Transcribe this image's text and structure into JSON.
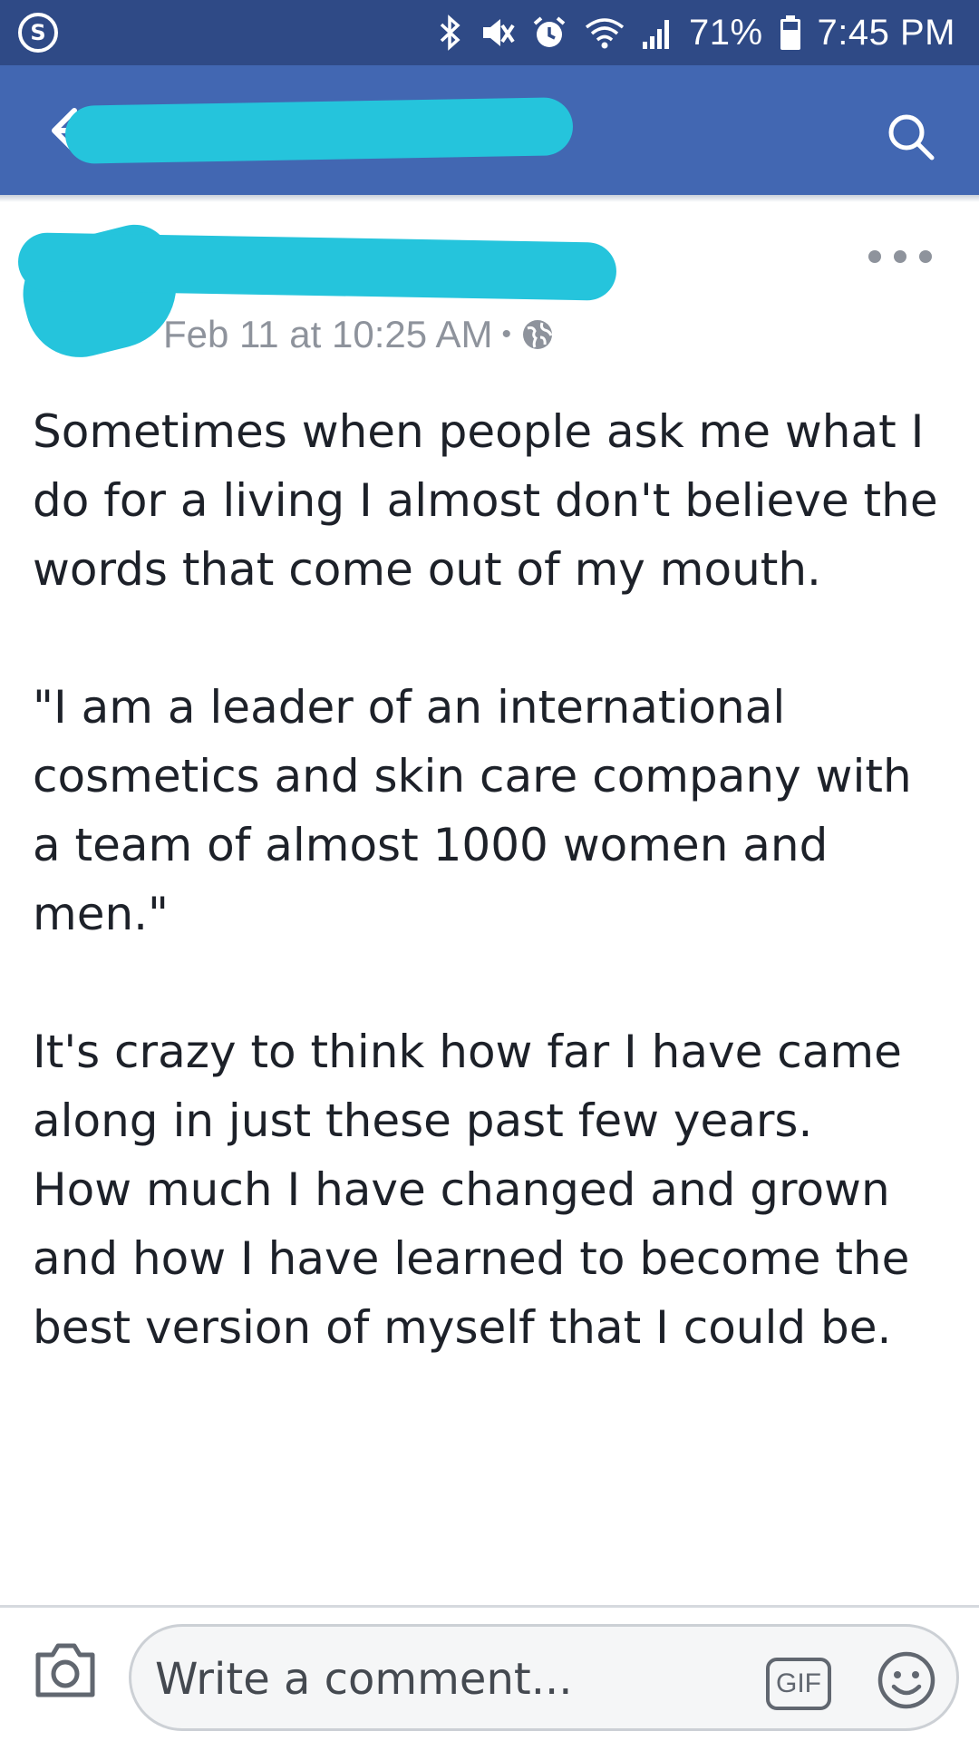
{
  "status_bar": {
    "battery_percent": "71%",
    "time": "7:45 PM",
    "icons": [
      "samsung-s-icon",
      "bluetooth-icon",
      "mute-icon",
      "alarm-icon",
      "wifi-icon",
      "signal-icon",
      "battery-icon"
    ]
  },
  "header": {
    "title": "",
    "back_icon": "back-arrow-icon",
    "search_icon": "search-icon",
    "bg_color": "#4267b2"
  },
  "post": {
    "author": "",
    "timestamp": "Feb 11 at 10:25 AM",
    "separator": "•",
    "privacy_icon": "globe-icon",
    "more_icon": "more-dots-icon",
    "paragraphs": [
      "Sometimes when people ask me what I do for a living I almost don't believe the words that come out of my mouth.",
      "\"I am a leader of an international cosmetics and skin care company with a team of almost 1000 women and men.\"",
      "It's crazy to think how far I have came along in just these past few years.",
      "How much I have changed and grown and how I have learned to become the best version of myself that I could be."
    ]
  },
  "comment_bar": {
    "placeholder": "Write a comment...",
    "gif_label": "GIF",
    "camera_icon": "camera-icon",
    "emoji_icon": "emoji-icon"
  },
  "colors": {
    "status_bar": "#2f4a86",
    "header": "#4267b2",
    "redaction": "#25c4dc",
    "meta_text": "#8e939c"
  }
}
